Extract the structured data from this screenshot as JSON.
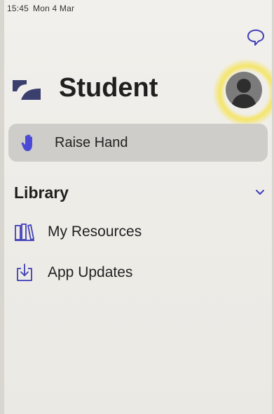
{
  "status_bar": {
    "time": "15:45",
    "date": "Mon 4 Mar"
  },
  "header": {
    "title": "Student"
  },
  "raise_hand": {
    "label": "Raise Hand"
  },
  "library": {
    "title": "Library",
    "items": [
      {
        "label": "My Resources",
        "icon": "books-icon"
      },
      {
        "label": "App Updates",
        "icon": "download-tray-icon"
      }
    ]
  },
  "colors": {
    "accent": "#4a4ad6",
    "highlight": "#f6e23c"
  }
}
